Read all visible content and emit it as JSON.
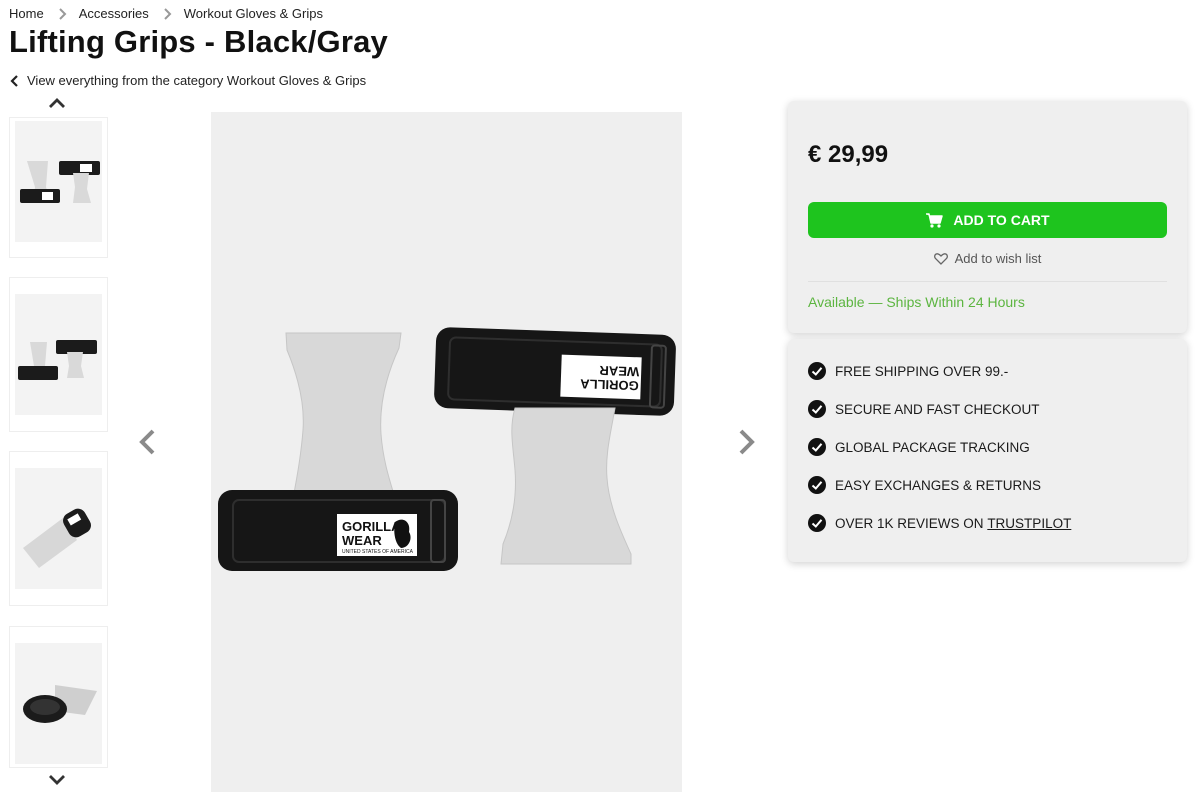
{
  "breadcrumb": {
    "items": [
      "Home",
      "Accessories",
      "Workout Gloves & Grips"
    ]
  },
  "product": {
    "title": "Lifting Grips - Black/Gray",
    "category_link": "View everything from the category Workout Gloves & Grips",
    "price": "€ 29,99",
    "add_to_cart": "ADD TO CART",
    "wishlist": "Add to wish list",
    "availability": "Available — Ships Within 24 Hours"
  },
  "usps": {
    "items": [
      "FREE SHIPPING OVER 99.-",
      "SECURE AND FAST CHECKOUT",
      "GLOBAL PACKAGE TRACKING",
      "EASY EXCHANGES & RETURNS"
    ],
    "reviews_prefix": "OVER 1K REVIEWS ON",
    "reviews_link": "TRUSTPILOT"
  },
  "brand_label": {
    "line1": "GORILLA",
    "line2": "WEAR",
    "line3": "UNITED STATES OF AMERICA"
  },
  "colors": {
    "accent_green": "#1ec41e",
    "availability_green": "#5cb540",
    "panel_bg": "#efefef"
  },
  "icons": [
    "chevron-right-icon",
    "chevron-left-icon",
    "chevron-up-icon",
    "chevron-down-icon",
    "cart-icon",
    "heart-icon",
    "check-circle-icon"
  ]
}
